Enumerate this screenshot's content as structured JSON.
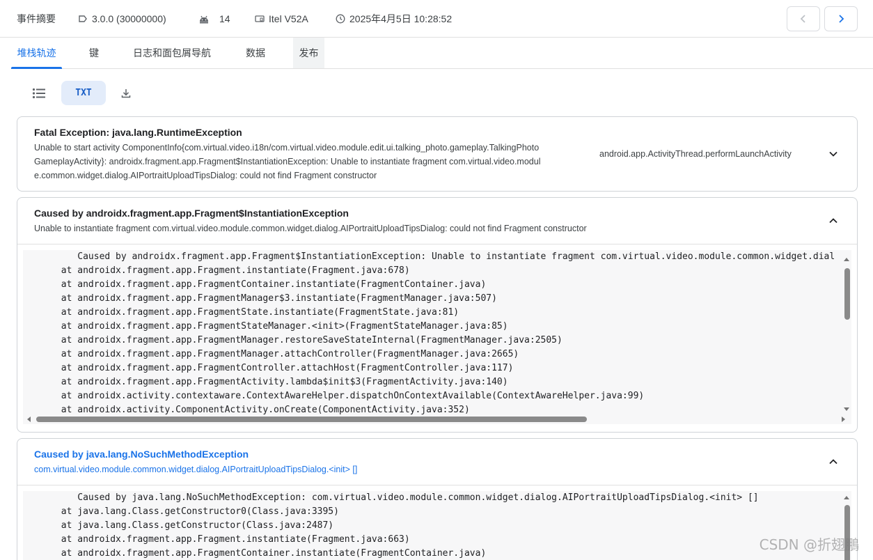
{
  "header": {
    "title": "事件摘要",
    "version": "3.0.0 (30000000)",
    "android_count": "14",
    "device": "Itel V52A",
    "datetime": "2025年4月5日 10:28:52"
  },
  "tabs": [
    "堆栈轨迹",
    "键",
    "日志和面包屑导航",
    "数据",
    "发布"
  ],
  "toolbar": {
    "txt_label": "TXT"
  },
  "cards": [
    {
      "title": "Fatal Exception: java.lang.RuntimeException",
      "desc_lines": [
        "Unable to start activity ComponentInfo{com.virtual.video.i18n/com.virtual.video.module.edit.ui.talking_photo.gameplay.TalkingPhoto",
        "GameplayActivity}: androidx.fragment.app.Fragment$InstantiationException: Unable to instantiate fragment com.virtual.video.modul",
        "e.common.widget.dialog.AIPortraitUploadTipsDialog: could not find Fragment constructor"
      ],
      "side": "android.app.ActivityThread.performLaunchActivity"
    },
    {
      "title": "Caused by androidx.fragment.app.Fragment$InstantiationException",
      "desc_lines": [
        "Unable to instantiate fragment com.virtual.video.module.common.widget.dialog.AIPortraitUploadTipsDialog: could not find Fragment constructor"
      ],
      "code": [
        "          Caused by androidx.fragment.app.Fragment$InstantiationException: Unable to instantiate fragment com.virtual.video.module.common.widget.dial",
        "       at androidx.fragment.app.Fragment.instantiate(Fragment.java:678)",
        "       at androidx.fragment.app.FragmentContainer.instantiate(FragmentContainer.java)",
        "       at androidx.fragment.app.FragmentManager$3.instantiate(FragmentManager.java:507)",
        "       at androidx.fragment.app.FragmentState.instantiate(FragmentState.java:81)",
        "       at androidx.fragment.app.FragmentStateManager.<init>(FragmentStateManager.java:85)",
        "       at androidx.fragment.app.FragmentManager.restoreSaveStateInternal(FragmentManager.java:2505)",
        "       at androidx.fragment.app.FragmentManager.attachController(FragmentManager.java:2665)",
        "       at androidx.fragment.app.FragmentController.attachHost(FragmentController.java:117)",
        "       at androidx.fragment.app.FragmentActivity.lambda$init$3(FragmentActivity.java:140)",
        "       at androidx.activity.contextaware.ContextAwareHelper.dispatchOnContextAvailable(ContextAwareHelper.java:99)",
        "       at androidx.activity.ComponentActivity.onCreate(ComponentActivity.java:352)"
      ]
    },
    {
      "title": "Caused by java.lang.NoSuchMethodException",
      "desc_lines": [
        "com.virtual.video.module.common.widget.dialog.AIPortraitUploadTipsDialog.<init> []"
      ],
      "code": [
        "          Caused by java.lang.NoSuchMethodException: com.virtual.video.module.common.widget.dialog.AIPortraitUploadTipsDialog.<init> []",
        "       at java.lang.Class.getConstructor0(Class.java:3395)",
        "       at java.lang.Class.getConstructor(Class.java:2487)",
        "       at androidx.fragment.app.Fragment.instantiate(Fragment.java:663)",
        "       at androidx.fragment.app.FragmentContainer.instantiate(FragmentContainer.java)"
      ]
    }
  ],
  "watermark": "CSDN @折翅鵬"
}
